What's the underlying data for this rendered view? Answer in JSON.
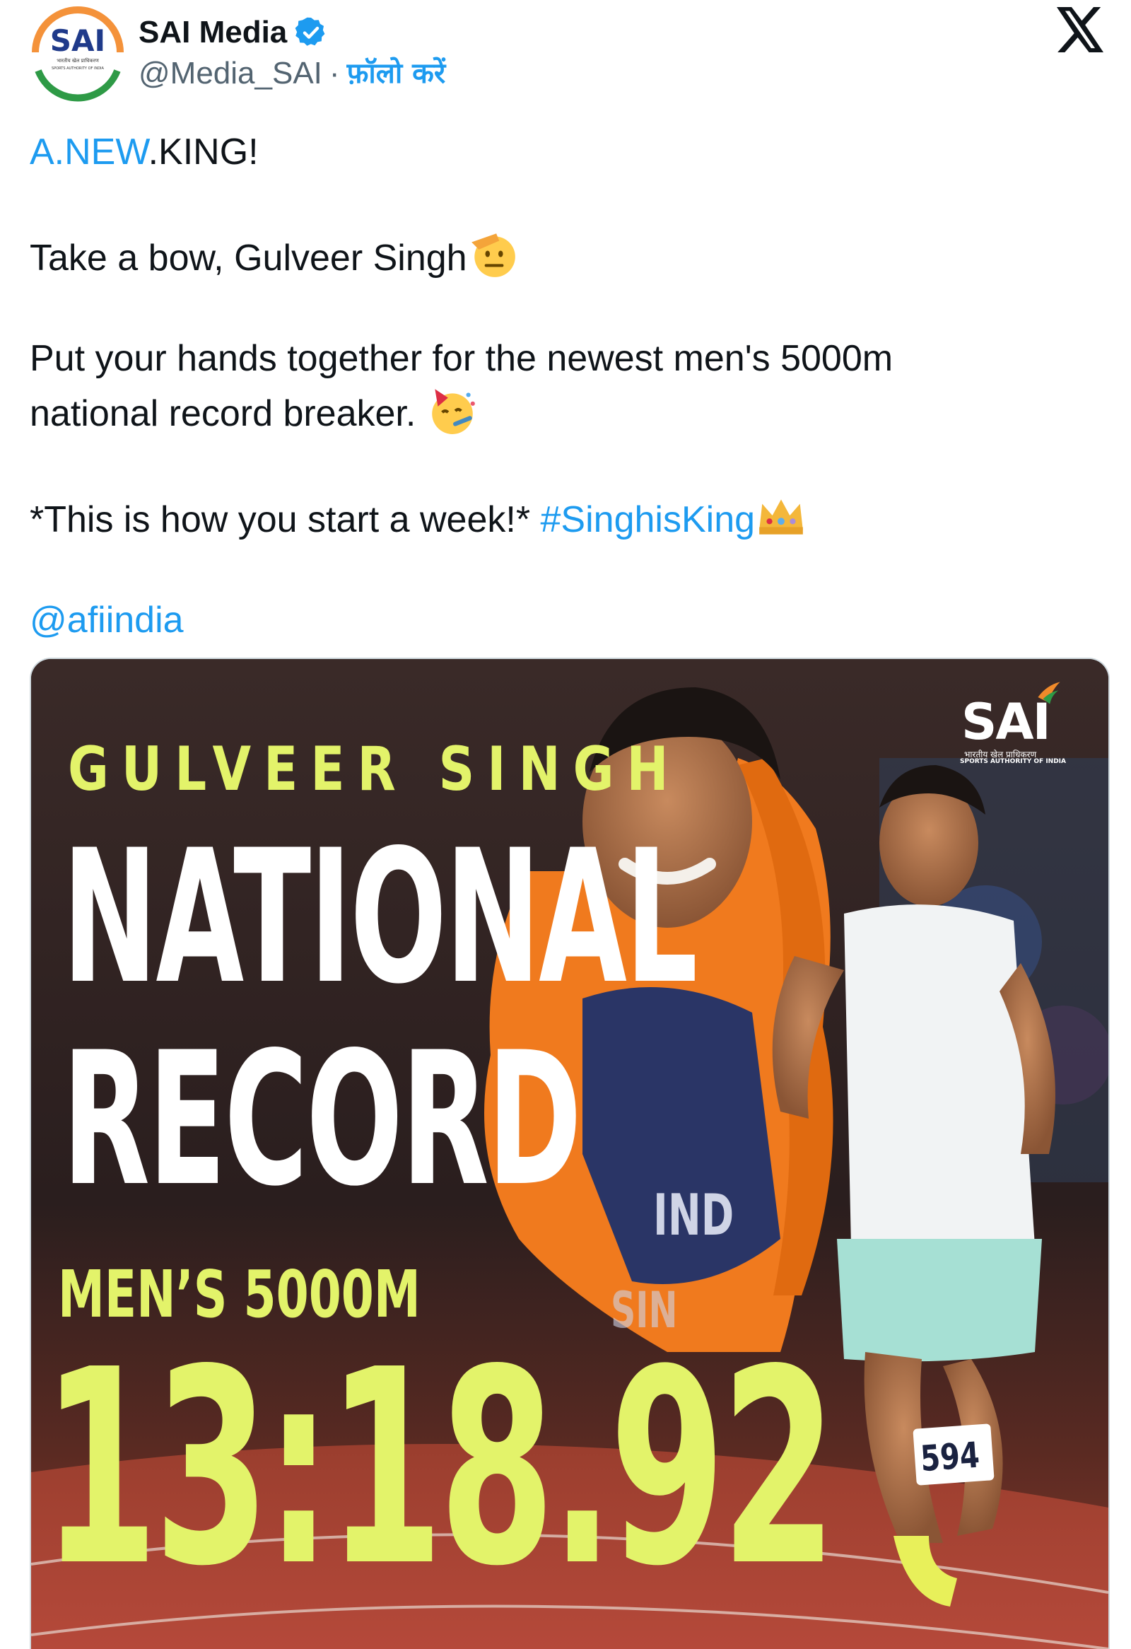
{
  "header": {
    "avatar_text": "SAI",
    "avatar_sub1": "भारतीय खेल प्राधिकरण",
    "avatar_sub2": "SPORTS AUTHORITY OF INDIA",
    "display_name": "SAI Media",
    "handle": "@Media_SAI",
    "separator": "·",
    "follow_label": "फ़ॉलो करें"
  },
  "tweet": {
    "line1_link": "A.NEW",
    "line1_rest": ".KING!",
    "line2": "Take a bow, Gulveer Singh",
    "line3": "Put your hands together for the newest men's 5000m",
    "line4": "national record breaker.",
    "line5_text": "*This is how you start a week!* ",
    "hashtag": "#SinghisKing",
    "mention": "@afiindia",
    "emojis": [
      "saluting-face-icon",
      "partying-face-icon",
      "crown-icon"
    ]
  },
  "media": {
    "athlete_name": "GULVEER SINGH",
    "headline_line1": "NATIONAL",
    "headline_line2": "RECORD",
    "event": "MEN’S 5000M",
    "time": "13:18.92",
    "logo_text": "SAI",
    "logo_sub1": "भारतीय खेल प्राधिकरण",
    "logo_sub2": "SPORTS AUTHORITY OF INDIA",
    "bib_number": "594",
    "jersey_text": "IND",
    "jersey_sub": "SIN"
  },
  "colors": {
    "link": "#1d9bf0",
    "verified": "#1d9bf0",
    "accent_yellow": "#e3f36a",
    "text": "#0f1419",
    "muted": "#536471"
  }
}
